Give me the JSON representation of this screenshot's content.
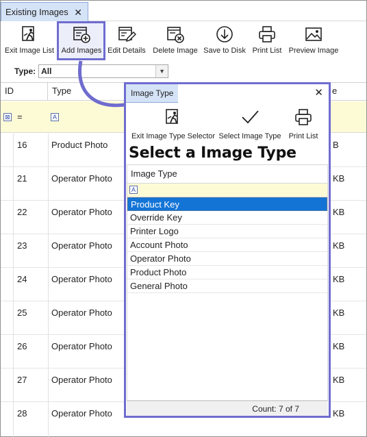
{
  "tab": {
    "title": "Existing Images",
    "close_glyph": "✕"
  },
  "toolbar": [
    {
      "key": "exit",
      "label": "Exit Image List",
      "icon": "exit-runner-icon"
    },
    {
      "key": "add",
      "label": "Add Images",
      "icon": "add-image-icon"
    },
    {
      "key": "edit",
      "label": "Edit Details",
      "icon": "edit-details-icon"
    },
    {
      "key": "delete",
      "label": "Delete Image",
      "icon": "delete-image-icon"
    },
    {
      "key": "save",
      "label": "Save to Disk",
      "icon": "download-icon"
    },
    {
      "key": "print",
      "label": "Print List",
      "icon": "printer-icon"
    },
    {
      "key": "preview",
      "label": "Preview Image",
      "icon": "image-preview-icon"
    }
  ],
  "type_filter": {
    "label": "Type:",
    "value": "All"
  },
  "grid": {
    "columns": [
      "ID",
      "Type",
      "e"
    ],
    "filter_operator": "=",
    "rows": [
      {
        "id": "16",
        "type": "Product Photo",
        "size": "B"
      },
      {
        "id": "21",
        "type": "Operator Photo",
        "size": "KB"
      },
      {
        "id": "22",
        "type": "Operator Photo",
        "size": "KB"
      },
      {
        "id": "23",
        "type": "Operator Photo",
        "size": "KB"
      },
      {
        "id": "24",
        "type": "Operator Photo",
        "size": "KB"
      },
      {
        "id": "25",
        "type": "Operator Photo",
        "size": "KB"
      },
      {
        "id": "26",
        "type": "Operator Photo",
        "size": "KB"
      },
      {
        "id": "27",
        "type": "Operator Photo",
        "size": "KB"
      },
      {
        "id": "28",
        "type": "Operator Photo",
        "size": "KB"
      }
    ]
  },
  "popup": {
    "tab_title": "Image Type",
    "close_glyph": "✕",
    "toolbar": [
      {
        "key": "exit",
        "label": "Exit Image Type Selector",
        "icon": "exit-runner-icon"
      },
      {
        "key": "select",
        "label": "Select Image Type",
        "icon": "checkmark-icon"
      },
      {
        "key": "print",
        "label": "Print List",
        "icon": "printer-icon"
      }
    ],
    "heading": "Select a Image Type",
    "column_header": "Image Type",
    "items": [
      "Product Key",
      "Override Key",
      "Printer Logo",
      "Account Photo",
      "Operator Photo",
      "Product Photo",
      "General Photo"
    ],
    "selected_index": 0,
    "count_text": "Count: 7 of 7"
  },
  "colors": {
    "highlight_border": "#6f6ccf",
    "selection": "#1374d6",
    "filter_row": "#fdfbd6",
    "tab_bg": "#d5e3f7"
  }
}
